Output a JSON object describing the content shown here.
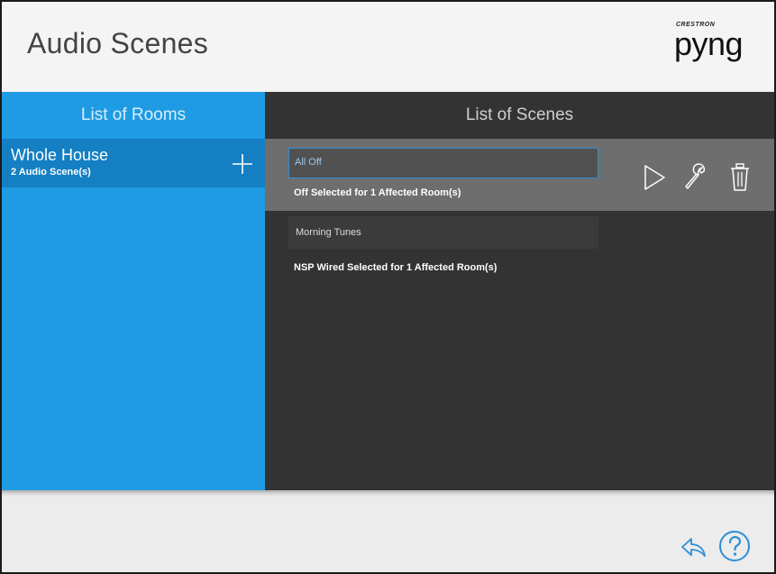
{
  "header": {
    "title": "Audio Scenes",
    "logo_brand": "CRESTRON",
    "logo_word": "pyng"
  },
  "rooms_panel": {
    "title": "List of Rooms",
    "items": [
      {
        "name": "Whole House",
        "count_label": "2 Audio Scene(s)"
      }
    ]
  },
  "scenes_panel": {
    "title": "List of Scenes",
    "scenes": [
      {
        "name": "All Off",
        "status": "Off Selected for 1 Affected Room(s)"
      },
      {
        "name": "Morning Tunes",
        "status": "NSP Wired Selected for 1 Affected Room(s)"
      }
    ]
  },
  "icons": {
    "add": "plus-icon",
    "play": "play-icon",
    "edit": "wrench-icon",
    "delete": "trash-icon",
    "back": "back-arrow-icon",
    "help": "help-icon"
  },
  "colors": {
    "rooms_panel": "#1e9be2",
    "rooms_selected": "#147fc2",
    "scenes_panel": "#333333",
    "scene_selected": "#6e6e6e",
    "accent": "#2c8fd6"
  }
}
